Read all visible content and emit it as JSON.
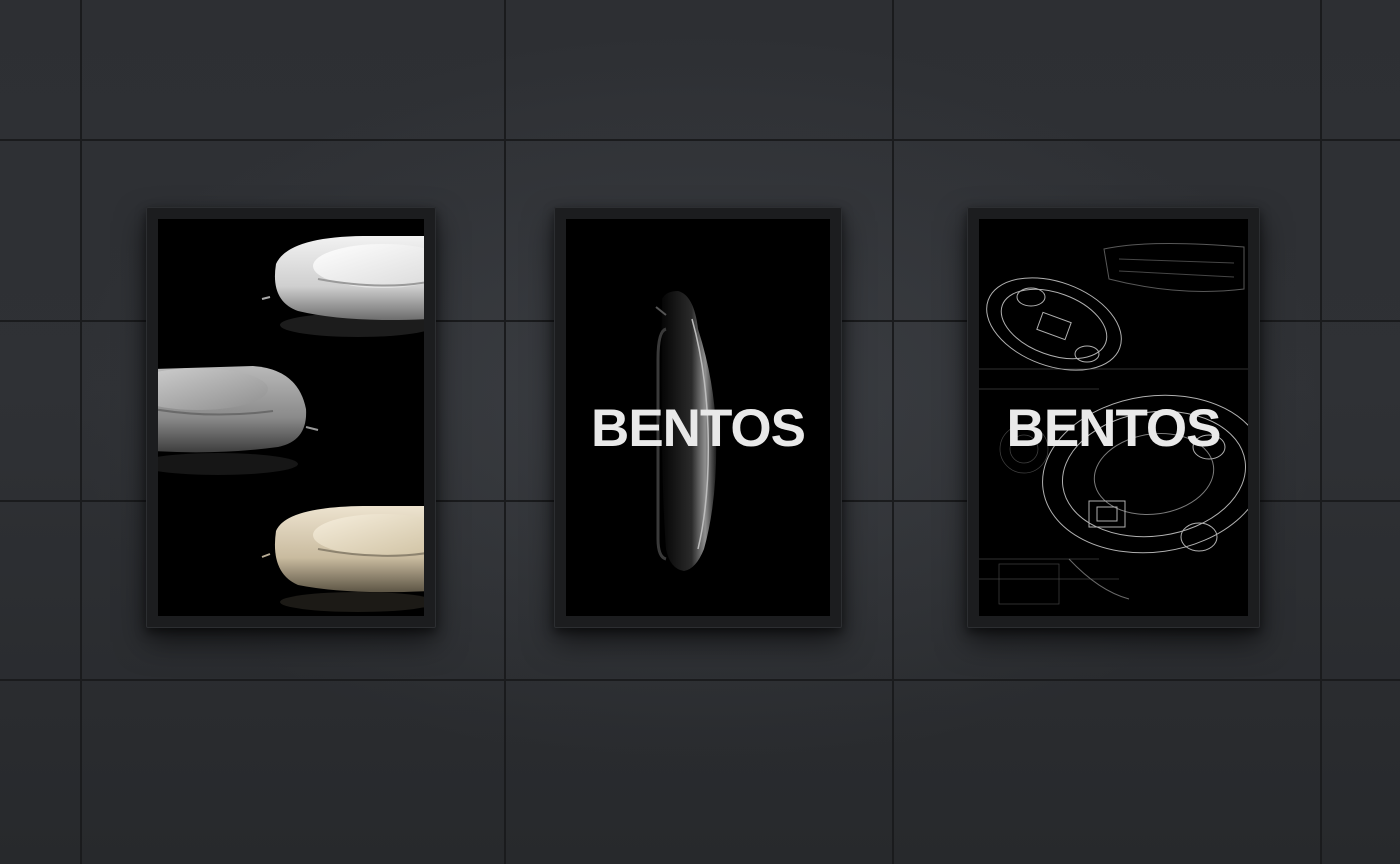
{
  "scene": {
    "wall_color": "#2d2f33",
    "frame_color": "#1c1d1f"
  },
  "posters": [
    {
      "id": "product-trio",
      "finishes": [
        "white",
        "grey",
        "beige"
      ]
    },
    {
      "id": "side-profile",
      "brand_text": "BENTOS"
    },
    {
      "id": "xray-wireframe",
      "brand_text": "BENTOS"
    }
  ]
}
